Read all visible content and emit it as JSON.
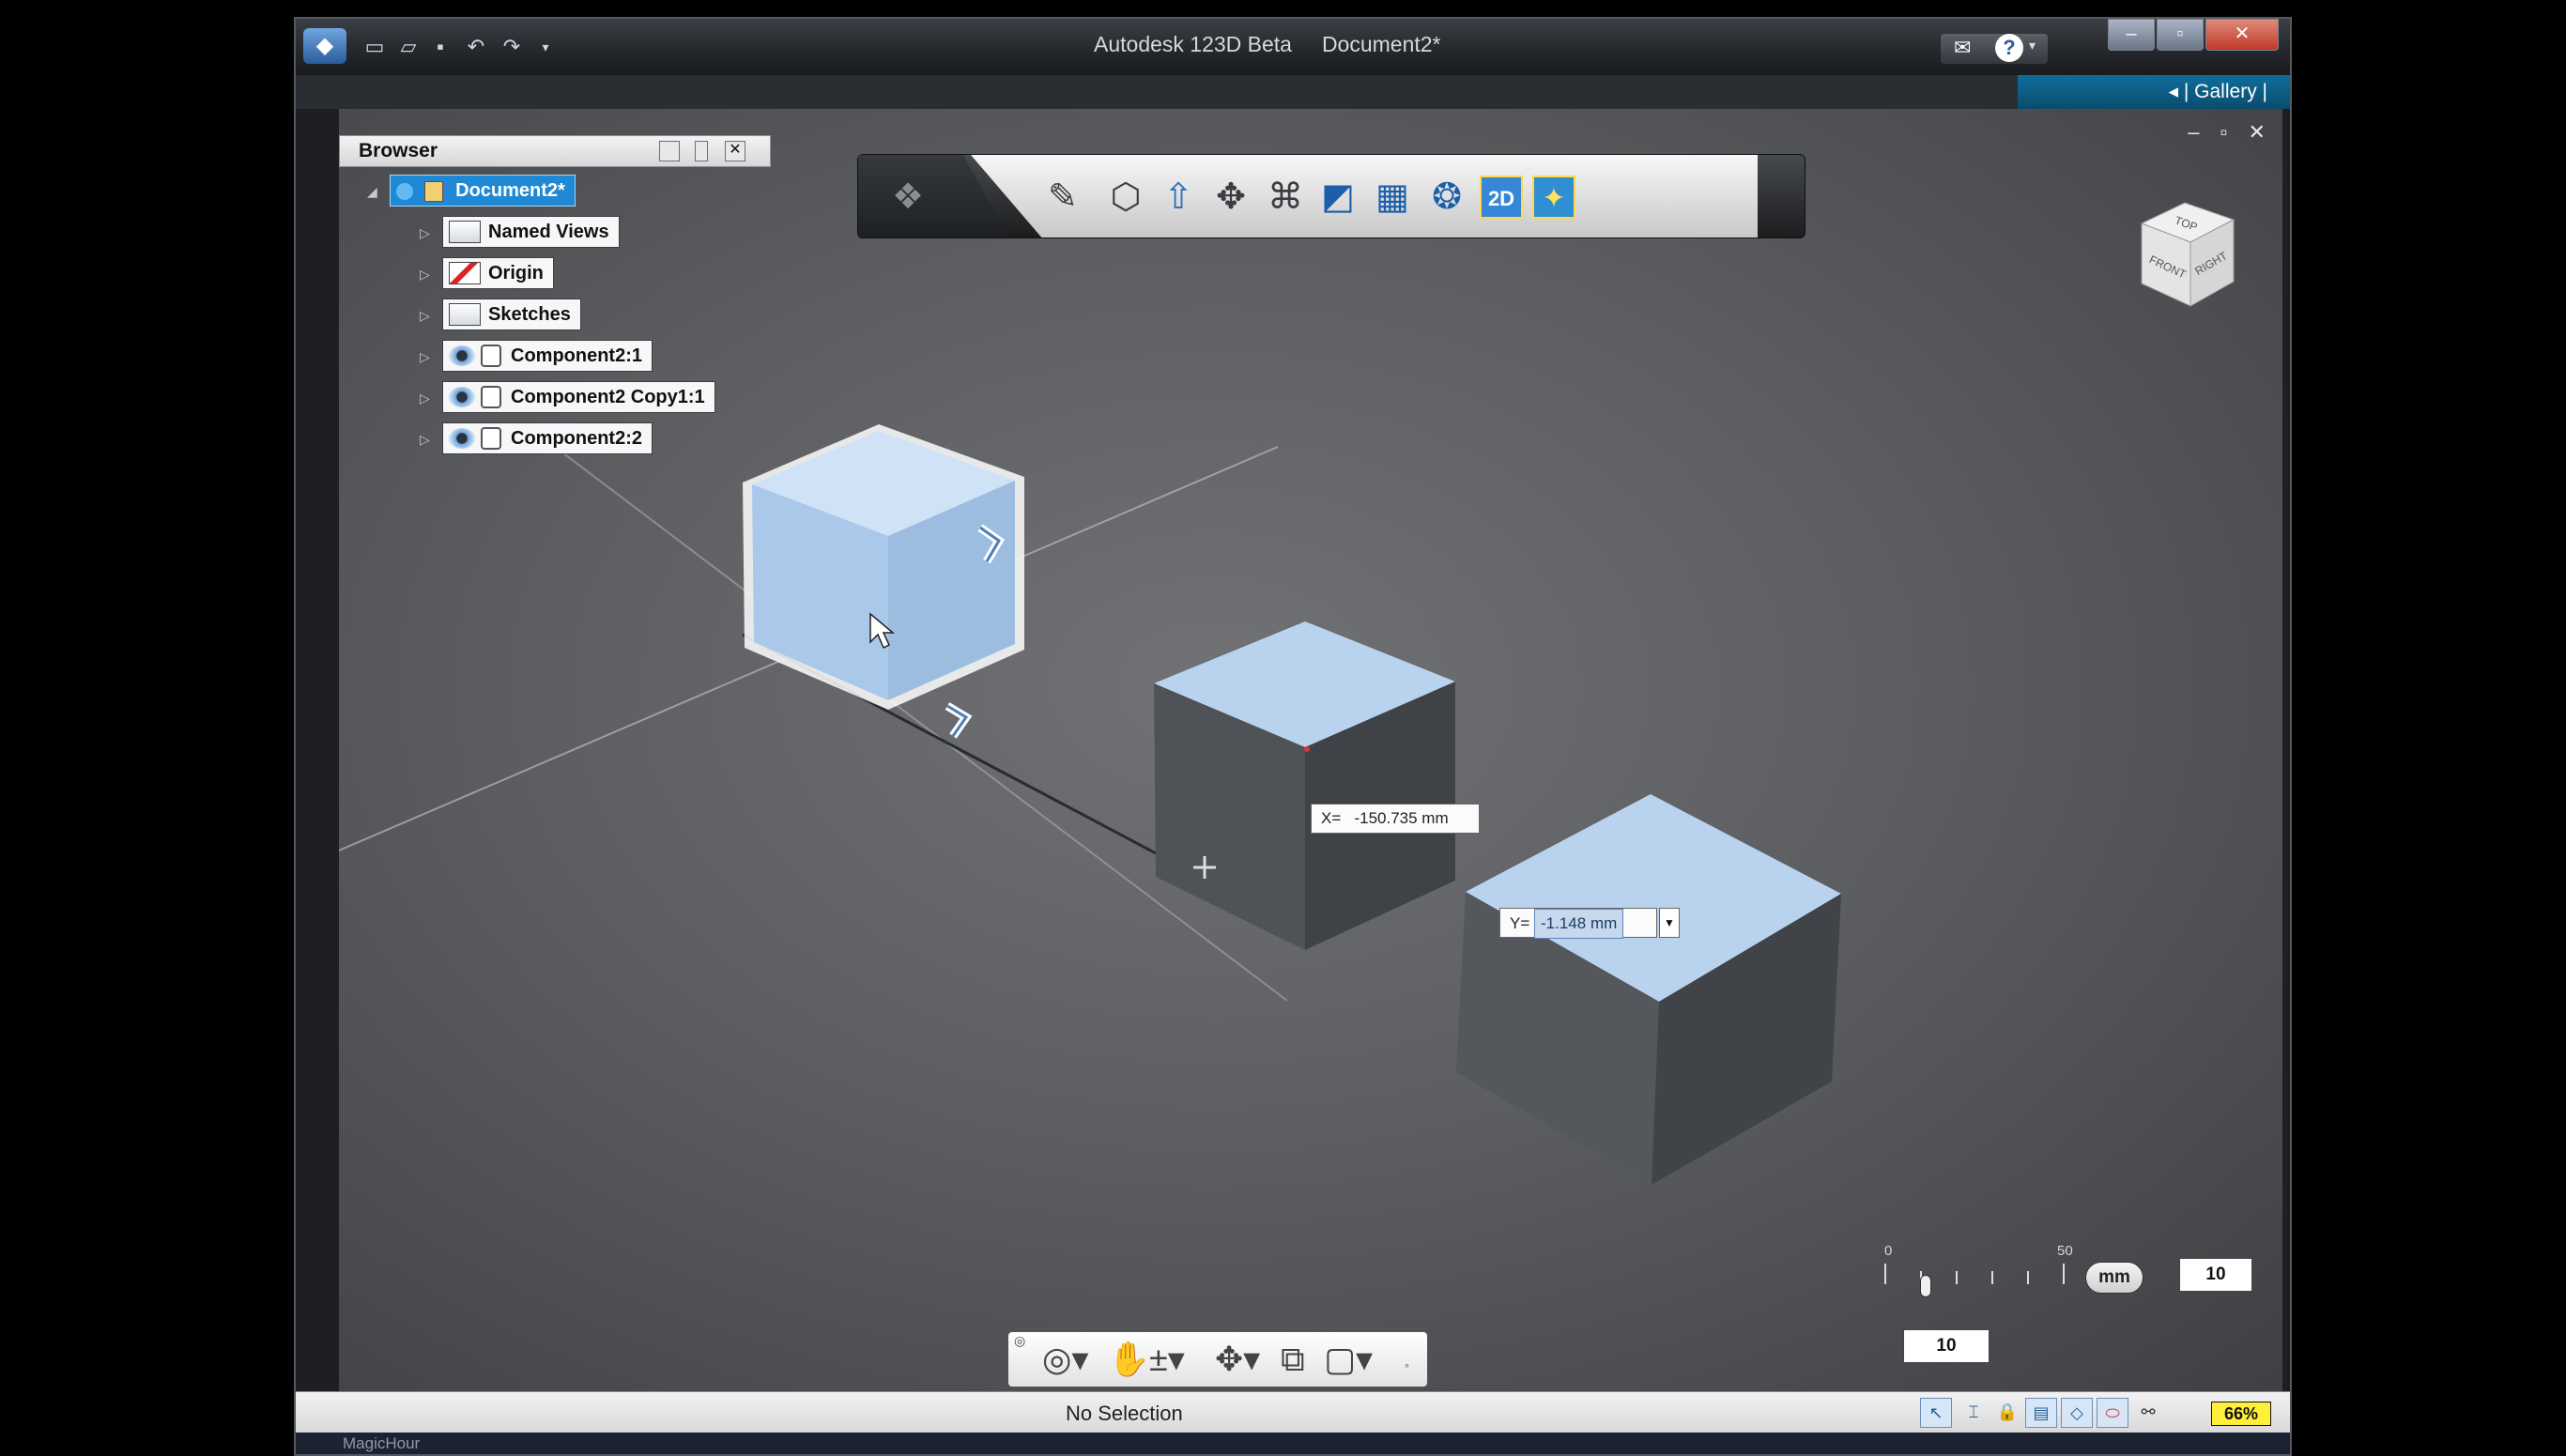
{
  "window": {
    "title": "Autodesk 123D Beta",
    "document": "Document2*",
    "gallery_label": "Gallery",
    "help_label": "?"
  },
  "quick_access": {
    "icons": [
      "app-menu-icon",
      "new-file-icon",
      "open-file-icon",
      "save-icon",
      "undo-icon",
      "redo-icon",
      "customize-dropdown-icon"
    ]
  },
  "browser": {
    "title": "Browser",
    "root": "Document2*",
    "items": [
      {
        "label": "Named Views",
        "icon": "folder-icon"
      },
      {
        "label": "Origin",
        "icon": "hidden-folder-icon"
      },
      {
        "label": "Sketches",
        "icon": "folder-icon"
      },
      {
        "label": "Component2:1",
        "icon": "component-icon"
      },
      {
        "label": "Component2 Copy1:1",
        "icon": "component-icon"
      },
      {
        "label": "Component2:2",
        "icon": "component-icon"
      }
    ]
  },
  "toolbar": {
    "icons": [
      "main-menu-icon",
      "sketch-icon",
      "primitives-icon",
      "construct-icon",
      "modify-icon",
      "pattern-icon",
      "combine-icon",
      "grouping-icon",
      "measure-icon",
      "2d-drawing-icon",
      "material-icon"
    ]
  },
  "view_cube": {
    "top": "TOP",
    "front": "FRONT",
    "right": "RIGHT"
  },
  "coords": {
    "x_label": "X=",
    "x_value": "-150.735 mm",
    "y_label": "Y=",
    "y_value": "-1.148 mm"
  },
  "grid": {
    "scale_min": "0",
    "scale_max": "50",
    "unit": "mm",
    "snap_value": "10",
    "grid_value": "10"
  },
  "status": {
    "text": "No Selection",
    "zoom": "66%"
  },
  "taskbar": {
    "label": "MagicHour"
  },
  "colors": {
    "selection": "#1f89d6",
    "cube_top": "#b9d3ee",
    "cube_side": "#55585d",
    "highlight": "#ffef3a"
  }
}
